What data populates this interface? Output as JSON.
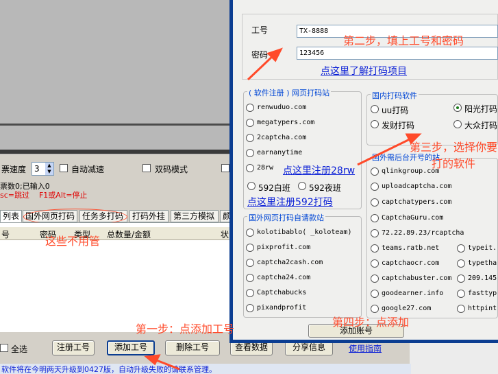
{
  "left": {
    "speed_label": "票速度",
    "speed_value": "3",
    "auto_slow": "自动减速",
    "double_mode": "双码模式",
    "stats": "票数0;已输入0",
    "hotkeys": "sc=跳过    F1或Alt=停止",
    "tabs": [
      "列表",
      "国外网页打码",
      "任务多打码",
      "打码外挂",
      "第三方模拟",
      "颜"
    ],
    "columns": [
      "号",
      "密码",
      "类型",
      "总数量/金额",
      "状"
    ],
    "select_all": "全选",
    "buttons": {
      "register": "注册工号",
      "add": "添加工号",
      "delete": "删除工号",
      "view": "查看数据",
      "share": "分享信息",
      "guide": "使用指南"
    },
    "status": "软件将在今明两天升级到0427版，自动升级失败的请联系管理。"
  },
  "dialog": {
    "id_label": "工号",
    "id_value": "TX-8888",
    "pwd_label": "密码",
    "pwd_value": "123456",
    "learn_link": "点这里了解打码项目",
    "group1_title": "( 软件注册 ) 网页打码站",
    "group1_items": [
      "renwuduo.com",
      "megatypers.com",
      "2captcha.com",
      "earnanytime",
      "28rw"
    ],
    "reg28_link": "点这里注册28rw",
    "bai": "592白班",
    "ye": "592夜班",
    "reg592_link": "点这里注册592打码",
    "group2_title": "国内打码软件",
    "group2_items": [
      "uu打码",
      "阳光打码",
      "发财打码",
      "大众打码"
    ],
    "group3_title": "国外需后台开号的站",
    "group3_items": [
      "qlinkgroup.com",
      "uploadcaptcha.com",
      "captchatypers.com",
      "CaptchaGuru.com",
      "72.22.89.23/rcaptcha",
      "teams.ratb.net",
      "typeit.",
      "captchaocr.com",
      "typetha",
      "captchabuster.com",
      "209.145",
      "goodearner.info",
      "fasttyp",
      "google27.com",
      "httpint"
    ],
    "group4_title": "国外网页打码自请款站",
    "group4_items": [
      "kolotibablo( _koloteam)",
      "pixprofit.com",
      "captcha2cash.com",
      "captcha24.com",
      "Captchabucks",
      "pixandprofit"
    ],
    "add_account": "添加账号"
  },
  "annotations": {
    "step1": "第一步：点添加工号",
    "step2": "第二步，填上工号和密码",
    "step3": "第三步，选择你要打的软件",
    "step4": "第四步：点添加",
    "ignore": "这些不用管"
  },
  "colors": {
    "annotation": "#ff4a2a",
    "link": "#0a1fd6",
    "dialog_border": "#0b3d91"
  }
}
